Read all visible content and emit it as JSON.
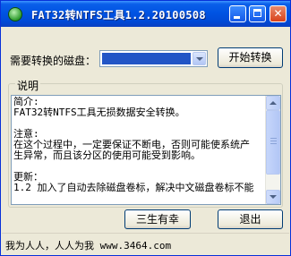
{
  "window": {
    "title": "FAT32转NTFS工具1.2.20100508",
    "icons": {
      "app": "app-icon",
      "minimize": "minimize-icon",
      "maximize": "maximize-icon",
      "close": "close-icon"
    }
  },
  "controls": {
    "disk_label": "需要转换的磁盘：",
    "disk_select_value": "",
    "start_button": "开始转换"
  },
  "description": {
    "group_title": "说明",
    "text": "简介:\nFAT32转NTFS工具无损数据安全转换。\n\n注意:\n在这个过程中，一定要保证不断电，否则可能使系统产\n生异常，而且该分区的使用可能受到影响。\n\n更新：\n1.2 加入了自动去除磁盘卷标，解决中文磁盘卷标不能"
  },
  "buttons": {
    "sansheng": "三生有幸",
    "exit": "退出"
  },
  "status": {
    "text": "我为人人，人人为我 www.3464.com"
  }
}
